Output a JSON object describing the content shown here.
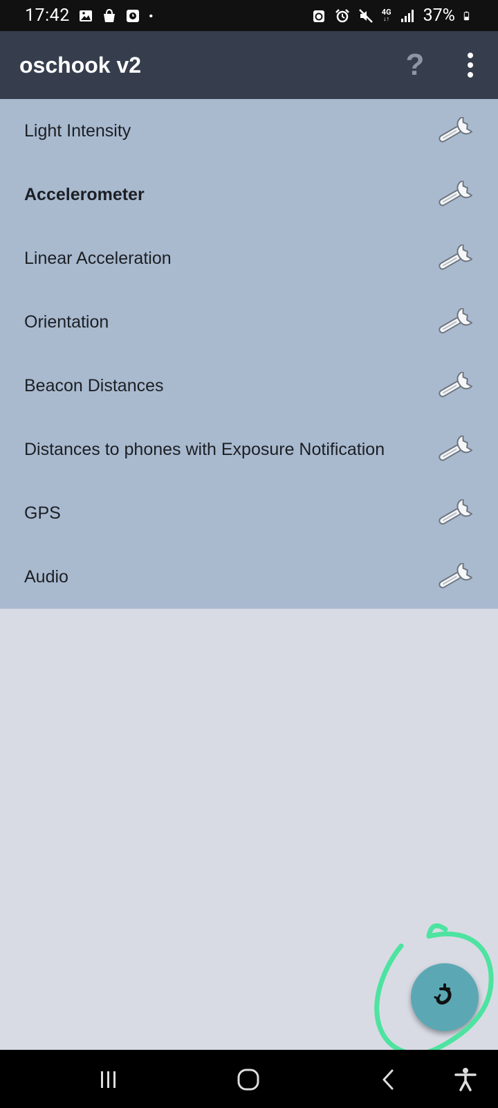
{
  "status_bar": {
    "time": "17:42",
    "network": "4G",
    "battery": "37%"
  },
  "app_bar": {
    "title": "oschook v2",
    "help_label": "?"
  },
  "sensors": [
    {
      "label": "Light Intensity",
      "active": false
    },
    {
      "label": "Accelerometer",
      "active": true
    },
    {
      "label": "Linear Acceleration",
      "active": false
    },
    {
      "label": "Orientation",
      "active": false
    },
    {
      "label": "Beacon Distances",
      "active": false
    },
    {
      "label": "Distances to phones with Exposure Notification",
      "active": false
    },
    {
      "label": "GPS",
      "active": false
    },
    {
      "label": "Audio",
      "active": false
    }
  ],
  "icons": {
    "settings": "wrench-icon",
    "fab": "hook-icon"
  },
  "colors": {
    "app_bar": "#363e4e",
    "list_bg": "#a9bacf",
    "page_bg": "#d8dbe4",
    "fab": "#5ba8b4",
    "annotation": "#4de3a0"
  }
}
